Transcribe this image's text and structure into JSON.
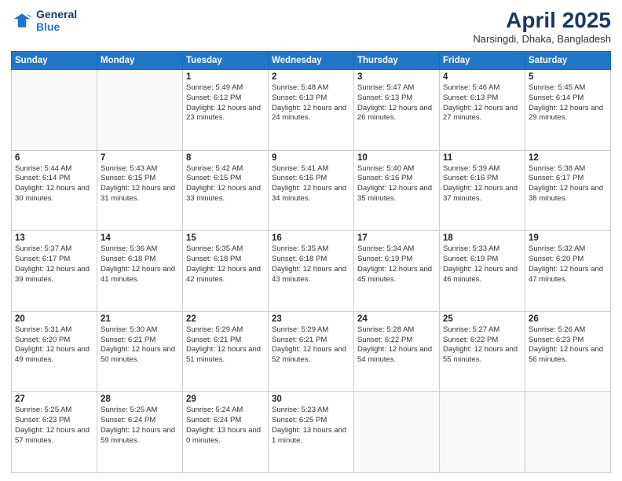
{
  "logo": {
    "line1": "General",
    "line2": "Blue"
  },
  "title": "April 2025",
  "subtitle": "Narsingdi, Dhaka, Bangladesh",
  "header": {
    "days": [
      "Sunday",
      "Monday",
      "Tuesday",
      "Wednesday",
      "Thursday",
      "Friday",
      "Saturday"
    ]
  },
  "weeks": [
    [
      {
        "day": "",
        "info": ""
      },
      {
        "day": "",
        "info": ""
      },
      {
        "day": "1",
        "info": "Sunrise: 5:49 AM\nSunset: 6:12 PM\nDaylight: 12 hours and 23 minutes."
      },
      {
        "day": "2",
        "info": "Sunrise: 5:48 AM\nSunset: 6:13 PM\nDaylight: 12 hours and 24 minutes."
      },
      {
        "day": "3",
        "info": "Sunrise: 5:47 AM\nSunset: 6:13 PM\nDaylight: 12 hours and 26 minutes."
      },
      {
        "day": "4",
        "info": "Sunrise: 5:46 AM\nSunset: 6:13 PM\nDaylight: 12 hours and 27 minutes."
      },
      {
        "day": "5",
        "info": "Sunrise: 5:45 AM\nSunset: 6:14 PM\nDaylight: 12 hours and 29 minutes."
      }
    ],
    [
      {
        "day": "6",
        "info": "Sunrise: 5:44 AM\nSunset: 6:14 PM\nDaylight: 12 hours and 30 minutes."
      },
      {
        "day": "7",
        "info": "Sunrise: 5:43 AM\nSunset: 6:15 PM\nDaylight: 12 hours and 31 minutes."
      },
      {
        "day": "8",
        "info": "Sunrise: 5:42 AM\nSunset: 6:15 PM\nDaylight: 12 hours and 33 minutes."
      },
      {
        "day": "9",
        "info": "Sunrise: 5:41 AM\nSunset: 6:16 PM\nDaylight: 12 hours and 34 minutes."
      },
      {
        "day": "10",
        "info": "Sunrise: 5:40 AM\nSunset: 6:16 PM\nDaylight: 12 hours and 35 minutes."
      },
      {
        "day": "11",
        "info": "Sunrise: 5:39 AM\nSunset: 6:16 PM\nDaylight: 12 hours and 37 minutes."
      },
      {
        "day": "12",
        "info": "Sunrise: 5:38 AM\nSunset: 6:17 PM\nDaylight: 12 hours and 38 minutes."
      }
    ],
    [
      {
        "day": "13",
        "info": "Sunrise: 5:37 AM\nSunset: 6:17 PM\nDaylight: 12 hours and 39 minutes."
      },
      {
        "day": "14",
        "info": "Sunrise: 5:36 AM\nSunset: 6:18 PM\nDaylight: 12 hours and 41 minutes."
      },
      {
        "day": "15",
        "info": "Sunrise: 5:35 AM\nSunset: 6:18 PM\nDaylight: 12 hours and 42 minutes."
      },
      {
        "day": "16",
        "info": "Sunrise: 5:35 AM\nSunset: 6:18 PM\nDaylight: 12 hours and 43 minutes."
      },
      {
        "day": "17",
        "info": "Sunrise: 5:34 AM\nSunset: 6:19 PM\nDaylight: 12 hours and 45 minutes."
      },
      {
        "day": "18",
        "info": "Sunrise: 5:33 AM\nSunset: 6:19 PM\nDaylight: 12 hours and 46 minutes."
      },
      {
        "day": "19",
        "info": "Sunrise: 5:32 AM\nSunset: 6:20 PM\nDaylight: 12 hours and 47 minutes."
      }
    ],
    [
      {
        "day": "20",
        "info": "Sunrise: 5:31 AM\nSunset: 6:20 PM\nDaylight: 12 hours and 49 minutes."
      },
      {
        "day": "21",
        "info": "Sunrise: 5:30 AM\nSunset: 6:21 PM\nDaylight: 12 hours and 50 minutes."
      },
      {
        "day": "22",
        "info": "Sunrise: 5:29 AM\nSunset: 6:21 PM\nDaylight: 12 hours and 51 minutes."
      },
      {
        "day": "23",
        "info": "Sunrise: 5:29 AM\nSunset: 6:21 PM\nDaylight: 12 hours and 52 minutes."
      },
      {
        "day": "24",
        "info": "Sunrise: 5:28 AM\nSunset: 6:22 PM\nDaylight: 12 hours and 54 minutes."
      },
      {
        "day": "25",
        "info": "Sunrise: 5:27 AM\nSunset: 6:22 PM\nDaylight: 12 hours and 55 minutes."
      },
      {
        "day": "26",
        "info": "Sunrise: 5:26 AM\nSunset: 6:23 PM\nDaylight: 12 hours and 56 minutes."
      }
    ],
    [
      {
        "day": "27",
        "info": "Sunrise: 5:25 AM\nSunset: 6:23 PM\nDaylight: 12 hours and 57 minutes."
      },
      {
        "day": "28",
        "info": "Sunrise: 5:25 AM\nSunset: 6:24 PM\nDaylight: 12 hours and 59 minutes."
      },
      {
        "day": "29",
        "info": "Sunrise: 5:24 AM\nSunset: 6:24 PM\nDaylight: 13 hours and 0 minutes."
      },
      {
        "day": "30",
        "info": "Sunrise: 5:23 AM\nSunset: 6:25 PM\nDaylight: 13 hours and 1 minute."
      },
      {
        "day": "",
        "info": ""
      },
      {
        "day": "",
        "info": ""
      },
      {
        "day": "",
        "info": ""
      }
    ]
  ]
}
